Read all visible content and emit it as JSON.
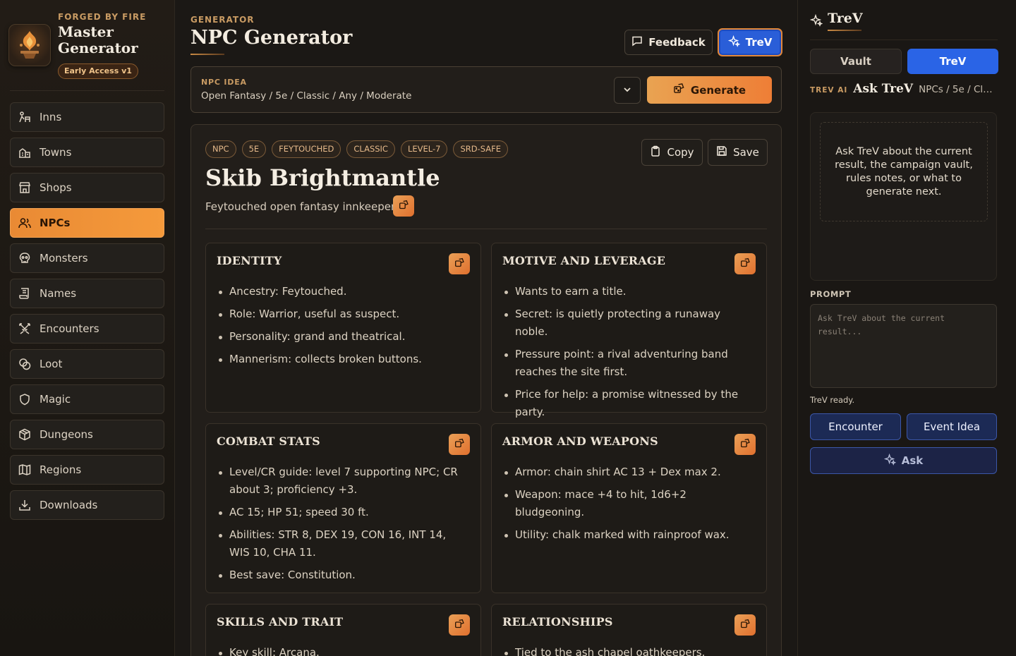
{
  "brand": {
    "kicker": "FORGED BY FIRE",
    "title": "Master Generator",
    "badge": "Early Access v1",
    "logo_icon": "forge-emblem-icon"
  },
  "nav": {
    "items": [
      {
        "label": "Inns",
        "icon": "inn-icon",
        "active": false
      },
      {
        "label": "Towns",
        "icon": "town-icon",
        "active": false
      },
      {
        "label": "Shops",
        "icon": "shop-icon",
        "active": false
      },
      {
        "label": "NPCs",
        "icon": "people-icon",
        "active": true
      },
      {
        "label": "Monsters",
        "icon": "skull-icon",
        "active": false
      },
      {
        "label": "Names",
        "icon": "scroll-icon",
        "active": false
      },
      {
        "label": "Encounters",
        "icon": "crossed-swords-icon",
        "active": false
      },
      {
        "label": "Loot",
        "icon": "coins-icon",
        "active": false
      },
      {
        "label": "Magic",
        "icon": "shield-icon",
        "active": false
      },
      {
        "label": "Dungeons",
        "icon": "box-icon",
        "active": false
      },
      {
        "label": "Regions",
        "icon": "map-icon",
        "active": false
      },
      {
        "label": "Downloads",
        "icon": "download-icon",
        "active": false
      }
    ]
  },
  "header": {
    "kicker": "GENERATOR",
    "title": "NPC Generator",
    "feedback_label": "Feedback",
    "trev_label": "TreV"
  },
  "idea": {
    "kicker": "NPC IDEA",
    "crumb": "Open Fantasy / 5e / Classic / Any / Moderate",
    "generate_label": "Generate"
  },
  "result": {
    "tags": [
      "NPC",
      "5E",
      "FEYTOUCHED",
      "CLASSIC",
      "LEVEL-7",
      "SRD-SAFE"
    ],
    "copy_label": "Copy",
    "save_label": "Save",
    "name": "Skib Brightmantle",
    "subtitle": "Feytouched open fantasy innkeeper",
    "cards": [
      {
        "title": "IDENTITY",
        "items": [
          "Ancestry: Feytouched.",
          "Role: Warrior, useful as suspect.",
          "Personality: grand and theatrical.",
          "Mannerism: collects broken buttons."
        ]
      },
      {
        "title": "MOTIVE AND LEVERAGE",
        "items": [
          "Wants to earn a title.",
          "Secret: is quietly protecting a runaway noble.",
          "Pressure point: a rival adventuring band reaches the site first.",
          "Price for help: a promise witnessed by the party."
        ]
      },
      {
        "title": "COMBAT STATS",
        "items": [
          "Level/CR guide: level 7 supporting NPC; CR about 3; proficiency +3.",
          "AC 15; HP 51; speed 30 ft.",
          "Abilities: STR 8, DEX 19, CON 16, INT 14, WIS 10, CHA 11.",
          "Best save: Constitution."
        ]
      },
      {
        "title": "ARMOR AND WEAPONS",
        "items": [
          "Armor: chain shirt AC 13 + Dex max 2.",
          "Weapon: mace +4 to hit, 1d6+2 bludgeoning.",
          "Utility: chalk marked with rainproof wax."
        ]
      },
      {
        "title": "SKILLS AND TRAIT",
        "items": [
          "Key skill: Arcana."
        ]
      },
      {
        "title": "RELATIONSHIPS",
        "items": [
          "Tied to the ash chapel oathkeepers."
        ]
      }
    ]
  },
  "panel": {
    "title": "TreV",
    "tab_vault": "Vault",
    "tab_trev": "TreV",
    "ask_kicker": "TREV AI",
    "ask_title": "Ask TreV",
    "ask_path": "NPCs / 5e / Clas...",
    "empty_message": "Ask TreV about the current result, the campaign vault, rules notes, or what to generate next.",
    "prompt_label": "PROMPT",
    "prompt_placeholder": "Ask TreV about the current result...",
    "prompt_value": "",
    "status": "TreV ready.",
    "encounter_label": "Encounter",
    "event_label": "Event Idea",
    "ask_label": "Ask"
  },
  "colors": {
    "accent_orange": "#f59a3b",
    "accent_blue": "#2a64e6",
    "kicker_gold": "#c99b63"
  }
}
